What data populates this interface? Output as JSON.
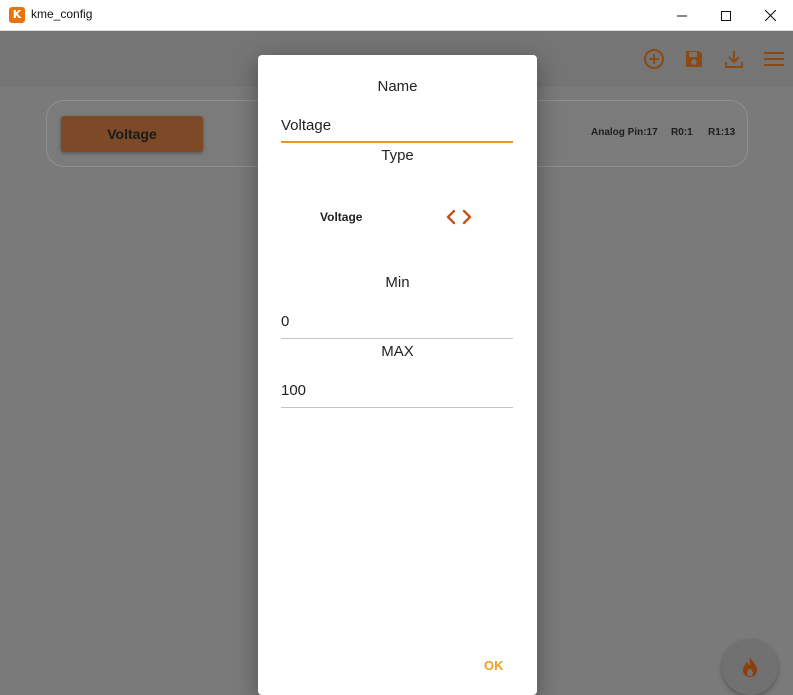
{
  "window": {
    "title": "kme_config",
    "app_icon_letter": "K"
  },
  "toolbar": {
    "icons": [
      "add-circle-icon",
      "save-icon",
      "download-icon",
      "menu-icon"
    ],
    "accent_color": "#b85a12"
  },
  "card": {
    "button_label": "Voltage",
    "analog_pin": "Analog Pin:17",
    "r0": "R0:1",
    "r1": "R1:13"
  },
  "dialog": {
    "name_label": "Name",
    "name_value": "Voltage",
    "type_label": "Type",
    "type_value": "Voltage",
    "min_label": "Min",
    "min_value": "0",
    "max_label": "MAX",
    "max_value": "100",
    "ok_label": "OK",
    "active_color": "#e8981e",
    "ok_color": "#f0a020"
  },
  "fab": {
    "icon": "flame-icon"
  }
}
